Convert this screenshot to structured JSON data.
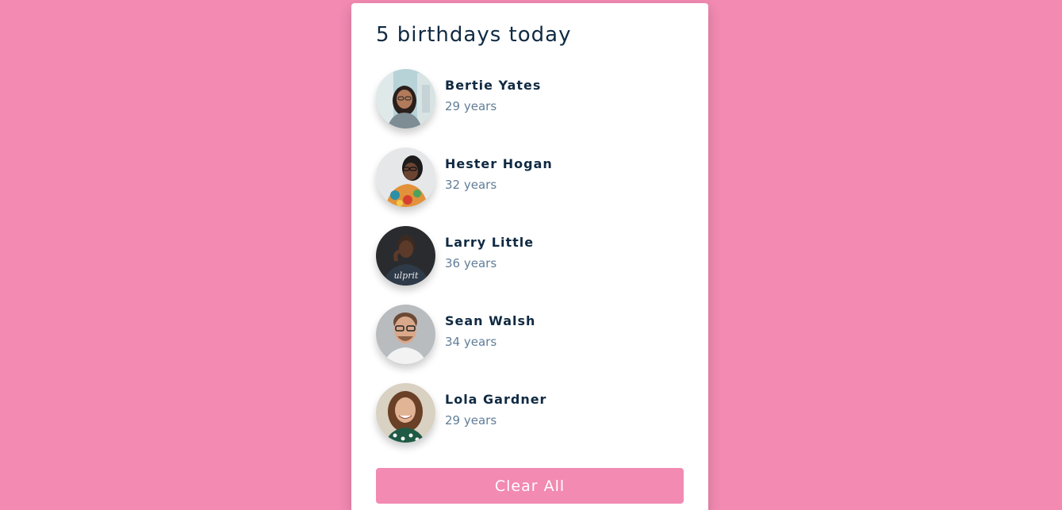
{
  "header": {
    "title": "5 birthdays today"
  },
  "people": [
    {
      "name": "Bertie Yates",
      "age": "29 years",
      "avatar_icon": "person-photo-icon"
    },
    {
      "name": "Hester Hogan",
      "age": "32 years",
      "avatar_icon": "person-photo-icon"
    },
    {
      "name": "Larry Little",
      "age": "36 years",
      "avatar_icon": "person-photo-icon"
    },
    {
      "name": "Sean Walsh",
      "age": "34 years",
      "avatar_icon": "person-photo-icon"
    },
    {
      "name": "Lola Gardner",
      "age": "29 years",
      "avatar_icon": "person-photo-icon"
    }
  ],
  "actions": {
    "clear_label": "Clear All"
  },
  "colors": {
    "background": "#f28ab2",
    "card": "#ffffff",
    "title_text": "#102a42",
    "secondary_text": "#617d98",
    "button": "#f28ab2"
  }
}
